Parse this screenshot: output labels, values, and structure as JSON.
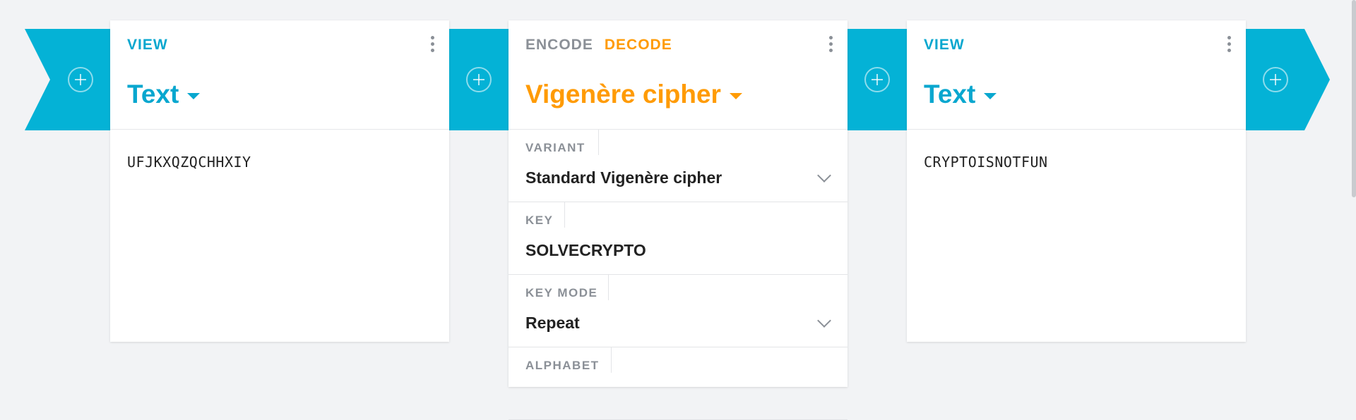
{
  "colors": {
    "accent": "#04b2d6",
    "view": "#08a7cf",
    "decode": "#ff9b05",
    "muted": "#8b9097"
  },
  "icons": {
    "add": "plus-circle-icon",
    "menu": "more-vertical-icon",
    "dropdown": "chevron-down-icon"
  },
  "cards": [
    {
      "tag": "VIEW",
      "title": "Text",
      "content": "UFJKXQZQCHHXIY"
    },
    {
      "tag_encode": "ENCODE",
      "tag_decode": "DECODE",
      "title": "Vigenère cipher",
      "settings": [
        {
          "label": "VARIANT",
          "value": "Standard Vigenère cipher"
        },
        {
          "label": "KEY",
          "value": "SOLVECRYPTO"
        },
        {
          "label": "KEY MODE",
          "value": "Repeat"
        },
        {
          "label": "ALPHABET",
          "value": ""
        }
      ]
    },
    {
      "tag": "VIEW",
      "title": "Text",
      "content": "CRYPTOISNOTFUN"
    }
  ]
}
